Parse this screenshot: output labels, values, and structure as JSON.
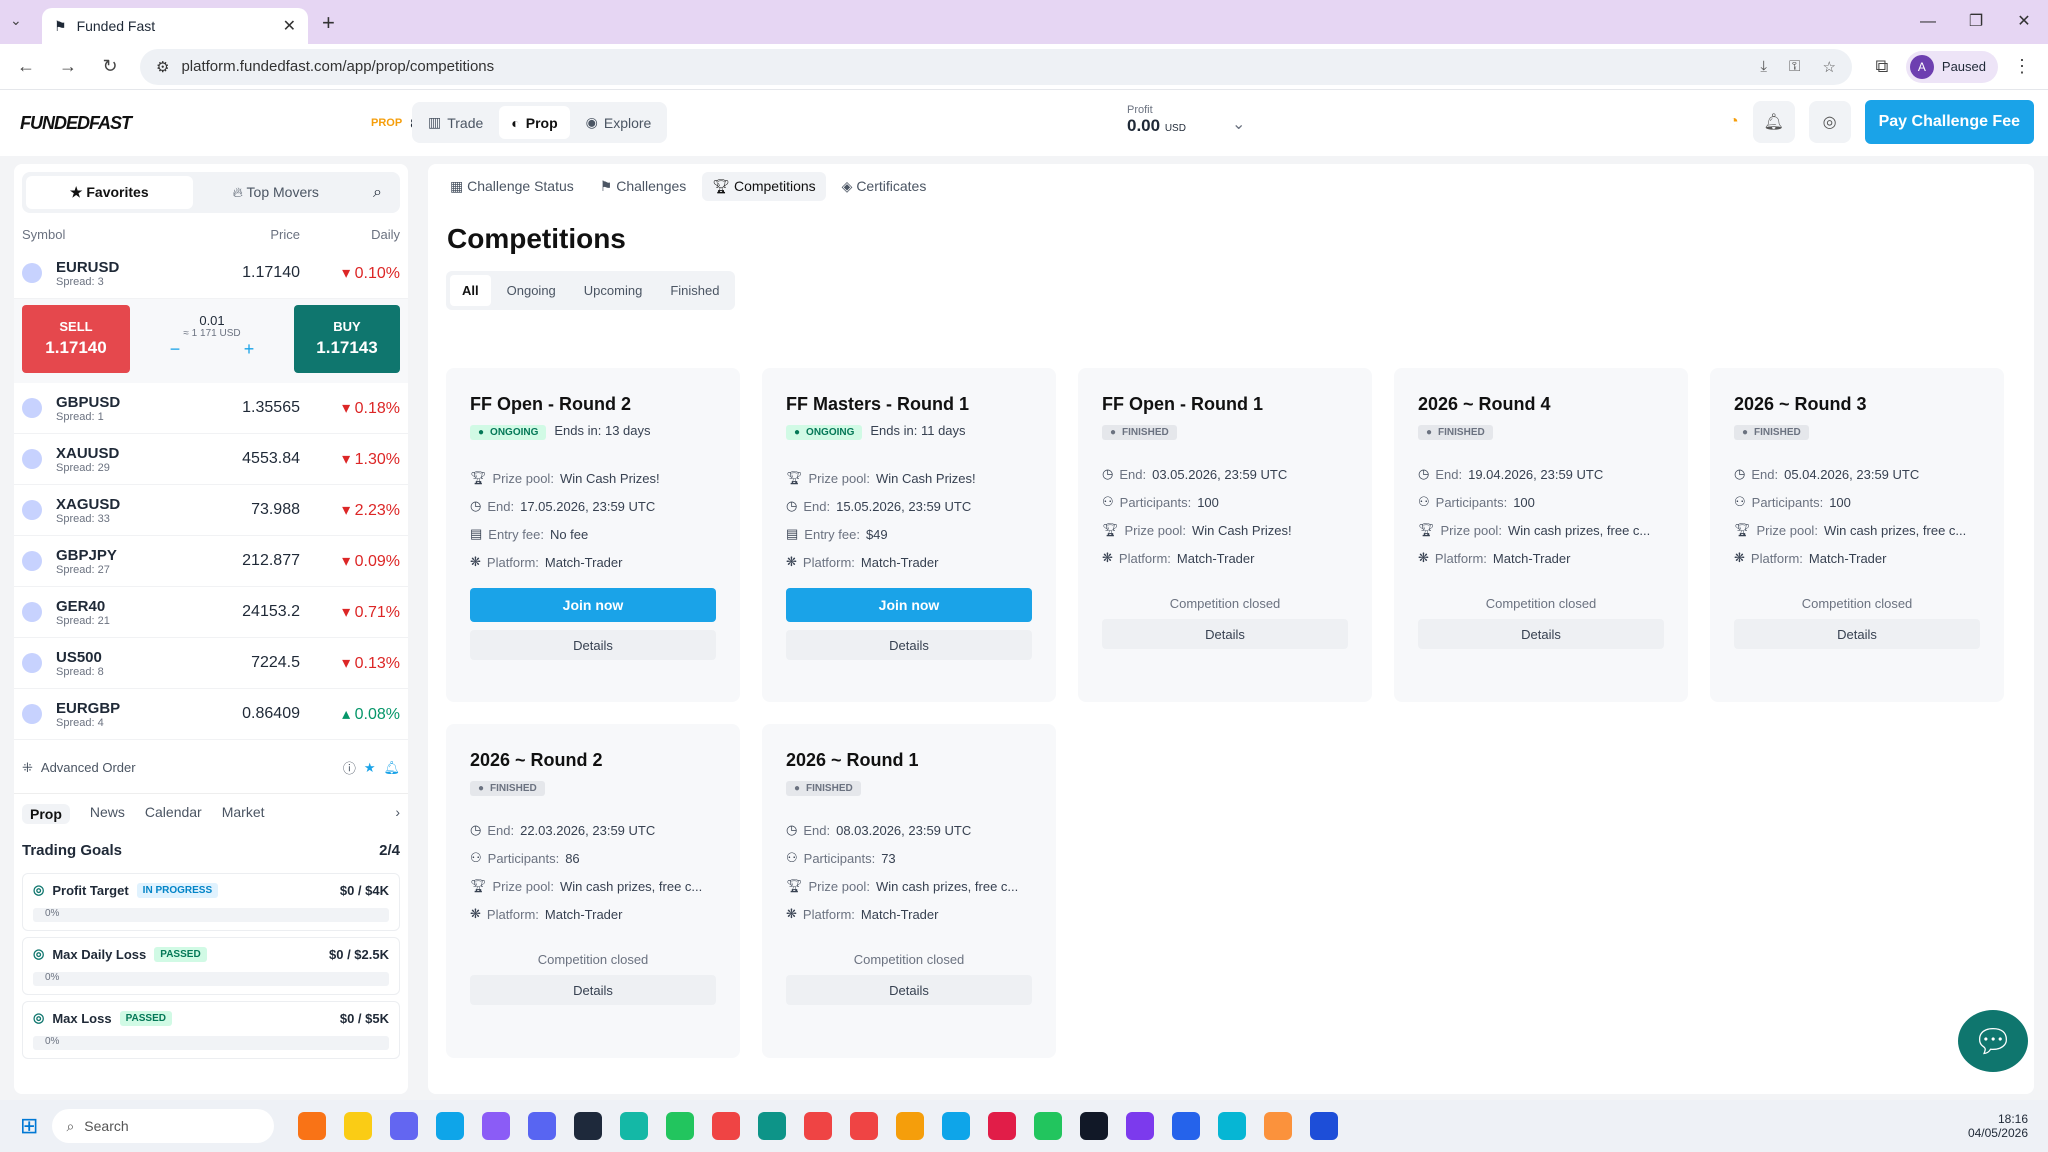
{
  "browser": {
    "tab_title": "Funded Fast",
    "url": "platform.fundedfast.com/app/prop/competitions",
    "profile_label": "Paused",
    "avatar_letter": "A"
  },
  "topbar": {
    "logo": "FUNDEDFAST",
    "prop_label": "PROP",
    "account_id": "850346",
    "nav": [
      "Trade",
      "Prop",
      "Explore"
    ],
    "profit_label": "Profit",
    "profit_value": "0.00",
    "profit_currency": "USD",
    "pay_button": "Pay Challenge Fee"
  },
  "sidebar": {
    "tabs": [
      "Favorites",
      "Top Movers"
    ],
    "headers": [
      "Symbol",
      "Price",
      "Daily"
    ],
    "symbols": [
      {
        "name": "EURUSD",
        "spread": "Spread: 3",
        "price": "1.17140",
        "change": "0.10%",
        "up": false
      },
      {
        "name": "GBPUSD",
        "spread": "Spread: 1",
        "price": "1.35565",
        "change": "0.18%",
        "up": false
      },
      {
        "name": "XAUUSD",
        "spread": "Spread: 29",
        "price": "4553.84",
        "change": "1.30%",
        "up": false
      },
      {
        "name": "XAGUSD",
        "spread": "Spread: 33",
        "price": "73.988",
        "change": "2.23%",
        "up": false
      },
      {
        "name": "GBPJPY",
        "spread": "Spread: 27",
        "price": "212.877",
        "change": "0.09%",
        "up": false
      },
      {
        "name": "GER40",
        "spread": "Spread: 21",
        "price": "24153.2",
        "change": "0.71%",
        "up": false
      },
      {
        "name": "US500",
        "spread": "Spread: 8",
        "price": "7224.5",
        "change": "0.13%",
        "up": false
      },
      {
        "name": "EURGBP",
        "spread": "Spread: 4",
        "price": "0.86409",
        "change": "0.08%",
        "up": true
      }
    ],
    "trade": {
      "sell_label": "SELL",
      "sell_price": "1.17140",
      "buy_label": "BUY",
      "buy_price": "1.17143",
      "lot": "0.01",
      "lot_usd": "≈ 1 171 USD"
    },
    "advanced_order": "Advanced Order",
    "bottom_tabs": [
      "Prop",
      "News",
      "Calendar",
      "Market"
    ],
    "goals_title": "Trading Goals",
    "goals_count": "2/4",
    "goals": [
      {
        "name": "Profit Target",
        "status": "IN PROGRESS",
        "value": "$0 / $4K",
        "pct": "0%"
      },
      {
        "name": "Max Daily Loss",
        "status": "PASSED",
        "value": "$0 / $2.5K",
        "pct": "0%"
      },
      {
        "name": "Max Loss",
        "status": "PASSED",
        "value": "$0 / $5K",
        "pct": "0%"
      }
    ]
  },
  "content": {
    "sub_tabs": [
      "Challenge Status",
      "Challenges",
      "Competitions",
      "Certificates"
    ],
    "title": "Competitions",
    "filters": [
      "All",
      "Ongoing",
      "Upcoming",
      "Finished"
    ],
    "cards": [
      {
        "title": "FF Open - Round 2",
        "status": "ONGOING",
        "ends": "Ends in: 13 days",
        "prize": "Win Cash Prizes!",
        "end": "17.05.2026, 23:59 UTC",
        "fee": "No fee",
        "platform": "Match-Trader"
      },
      {
        "title": "FF Masters - Round 1",
        "status": "ONGOING",
        "ends": "Ends in: 11 days",
        "prize": "Win Cash Prizes!",
        "end": "15.05.2026, 23:59 UTC",
        "fee": "$49",
        "platform": "Match-Trader"
      },
      {
        "title": "FF Open - Round 1",
        "status": "FINISHED",
        "end": "03.05.2026, 23:59 UTC",
        "participants": "100",
        "prize": "Win Cash Prizes!",
        "platform": "Match-Trader"
      },
      {
        "title": "2026 ~ Round 4",
        "status": "FINISHED",
        "end": "19.04.2026, 23:59 UTC",
        "participants": "100",
        "prize": "Win cash prizes, free c...",
        "platform": "Match-Trader"
      },
      {
        "title": "2026 ~ Round 3",
        "status": "FINISHED",
        "end": "05.04.2026, 23:59 UTC",
        "participants": "100",
        "prize": "Win cash prizes, free c...",
        "platform": "Match-Trader"
      },
      {
        "title": "2026 ~ Round 2",
        "status": "FINISHED",
        "end": "22.03.2026, 23:59 UTC",
        "participants": "86",
        "prize": "Win cash prizes, free c...",
        "platform": "Match-Trader"
      },
      {
        "title": "2026 ~ Round 1",
        "status": "FINISHED",
        "end": "08.03.2026, 23:59 UTC",
        "participants": "73",
        "prize": "Win cash prizes, free c...",
        "platform": "Match-Trader"
      }
    ],
    "labels": {
      "prize": "Prize pool:",
      "end": "End:",
      "fee": "Entry fee:",
      "platform": "Platform:",
      "participants": "Participants:",
      "join": "Join now",
      "details": "Details",
      "closed": "Competition closed"
    }
  },
  "taskbar": {
    "search": "Search",
    "time": "18:16",
    "date": "04/05/2026"
  }
}
